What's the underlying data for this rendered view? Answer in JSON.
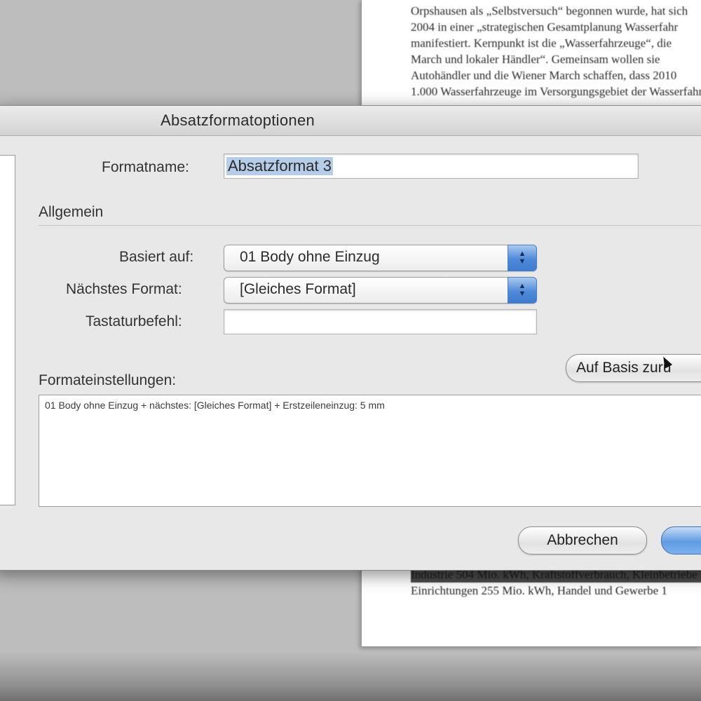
{
  "document": {
    "top_lines": [
      "Orpshausen als „Selbstversuch“ begonnen wurde, hat sich",
      "2004 in einer „strategischen Gesamtplanung Wasserfahr",
      "manifestiert. Kernpunkt ist die „Wasserfahrzeuge“, die",
      "March und lokaler Händler“. Gemeinsam wollen sie",
      "Autohändler und die Wiener March schaffen, dass 2010",
      "1.000 Wasserfahrzeuge im Versorgungsgebiet der Wasserfahr"
    ],
    "bottom_lines": [
      "Industrie 504 Mio. kWh, Kraftstoffverbrauch, Kleinbetriebe",
      "Einrichtungen 255 Mio. kWh, Handel und Gewerbe 1"
    ]
  },
  "dialog": {
    "title": "Absatzformatoptionen",
    "format_name_label": "Formatname:",
    "format_name_value": "Absatzformat 3",
    "section_general": "Allgemein",
    "based_on_label": "Basiert auf:",
    "based_on_value": "01 Body ohne Einzug",
    "next_format_label": "Nächstes Format:",
    "next_format_value": "[Gleiches Format]",
    "shortcut_label": "Tastaturbefehl:",
    "shortcut_value": "",
    "reset_button": "Auf Basis zurü",
    "settings_label": "Formateinstellungen:",
    "settings_text": "01 Body ohne Einzug + nächstes: [Gleiches Format] + Erstzeileneinzug: 5 mm",
    "cancel_button": "Abbrechen"
  }
}
